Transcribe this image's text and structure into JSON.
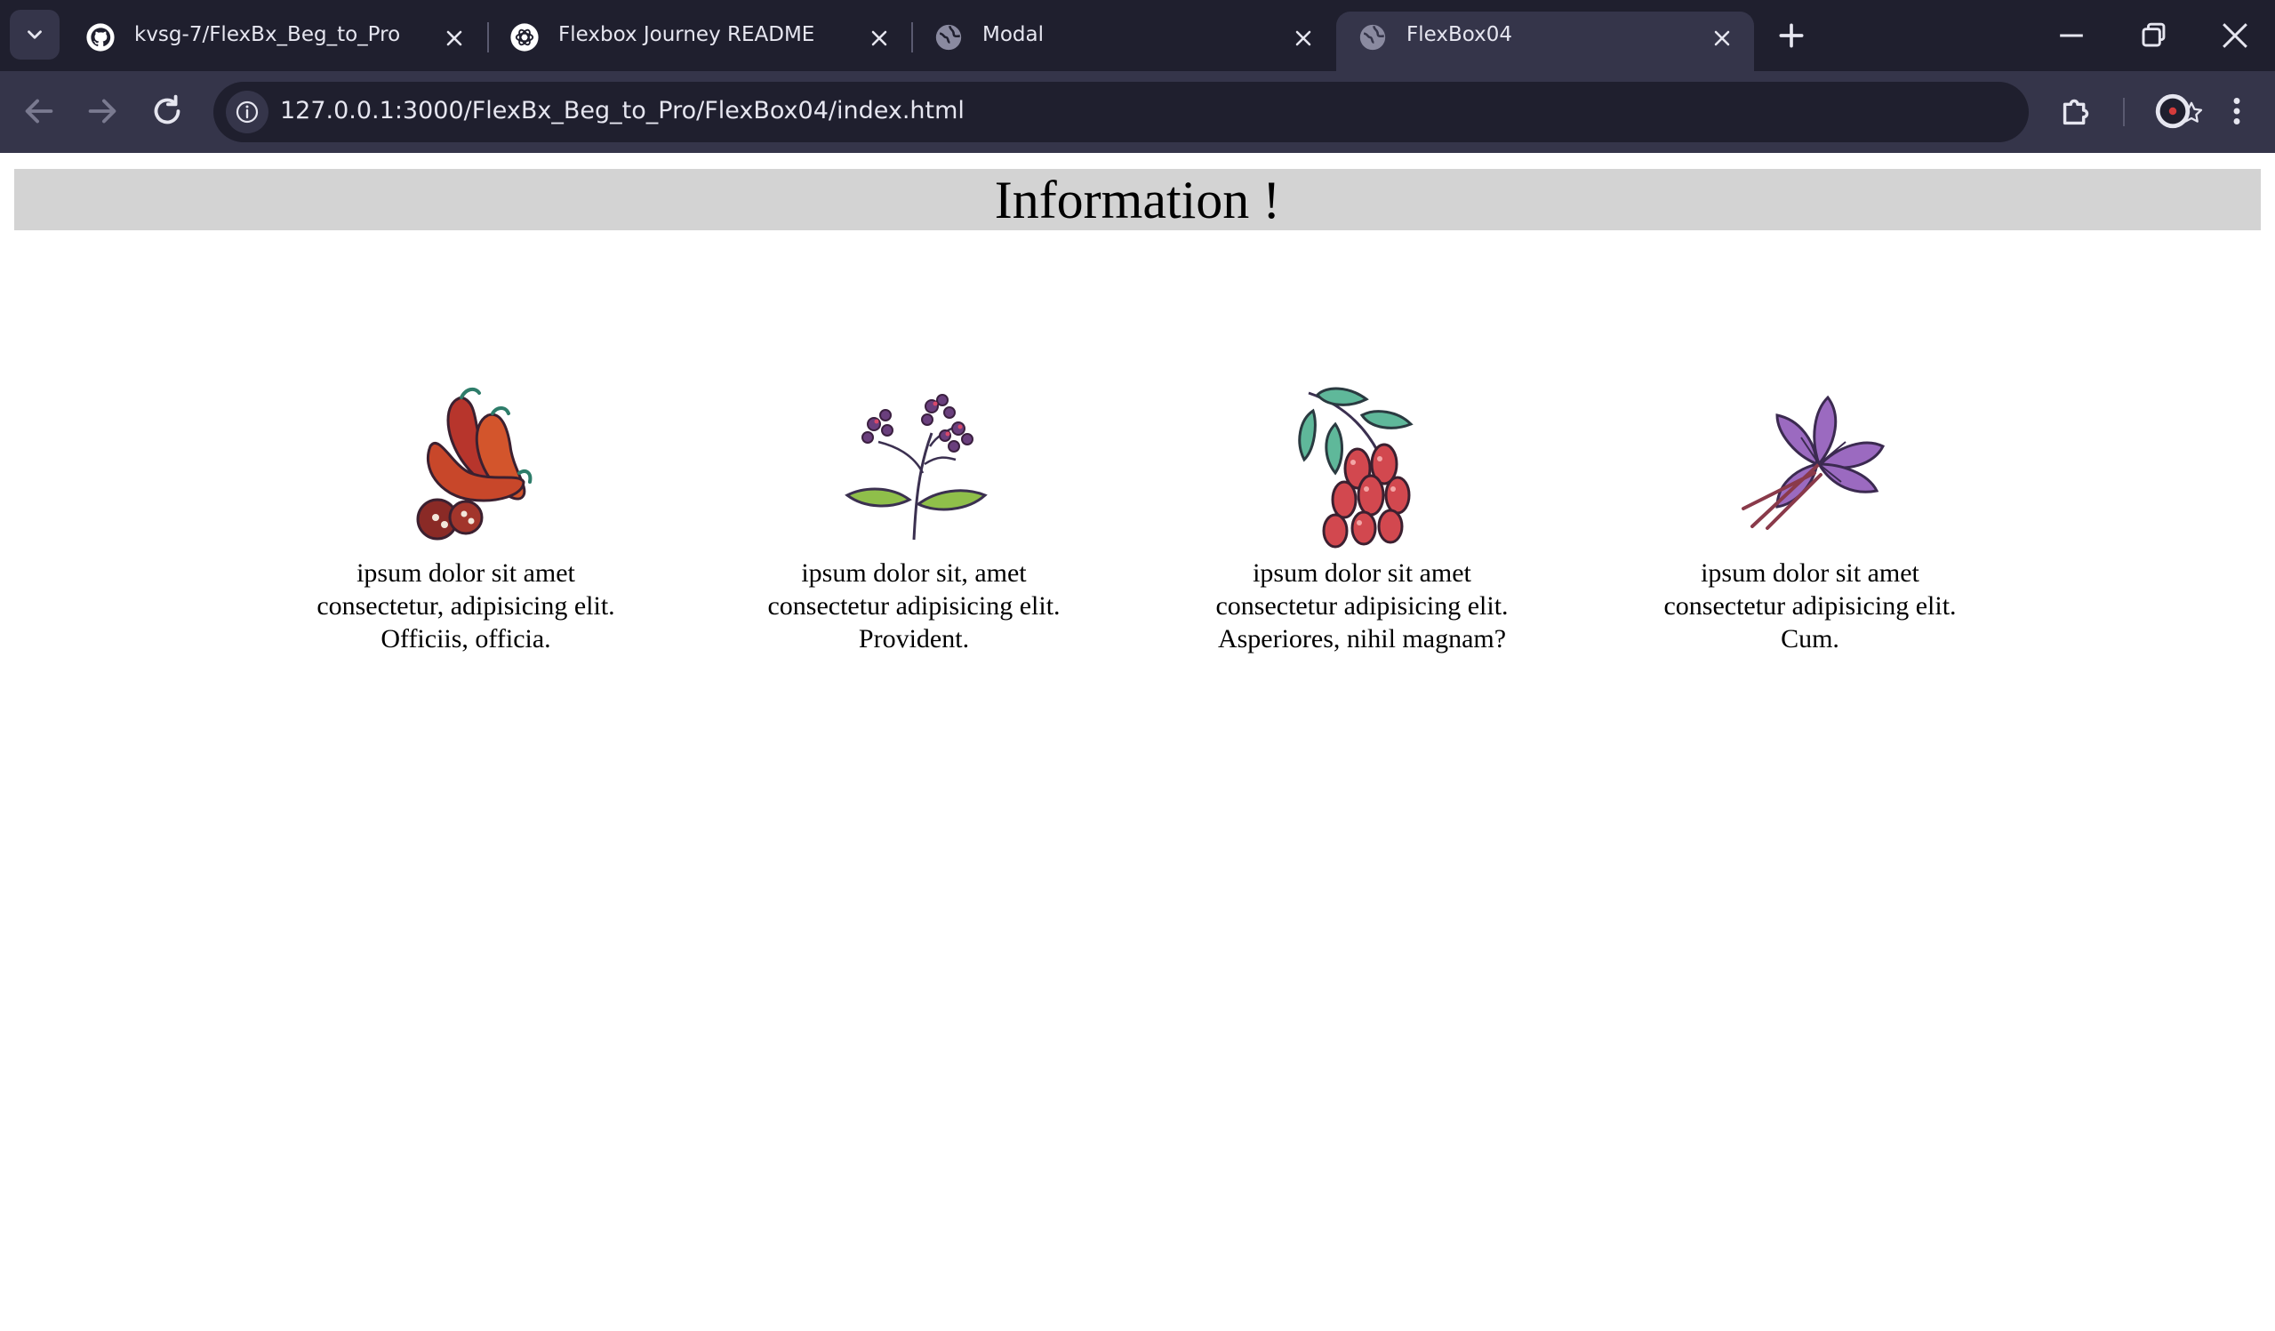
{
  "browser": {
    "tabs": [
      {
        "title": "kvsg-7/FlexBx_Beg_to_Pro",
        "favicon": "github-icon",
        "active": false
      },
      {
        "title": "Flexbox Journey README",
        "favicon": "openai-icon",
        "active": false
      },
      {
        "title": "Modal",
        "favicon": "globe-icon",
        "active": false
      },
      {
        "title": "FlexBox04",
        "favicon": "globe-icon",
        "active": true
      }
    ],
    "address": {
      "host": "127.0.0.1",
      "rest": ":3000/FlexBx_Beg_to_Pro/FlexBox04/index.html"
    },
    "colors": {
      "tabstrip": "#1f1f2e",
      "toolbar": "#35354a",
      "omnibox": "#1f1f2e",
      "text": "#e6e6f0"
    }
  },
  "page": {
    "heading": "Information !",
    "banner_color": "#d3d3d3",
    "cards": [
      {
        "icon": "chili-peppers-icon",
        "lines": [
          "ipsum dolor sit amet",
          "consectetur, adipisicing elit.",
          "Officiis, officia."
        ]
      },
      {
        "icon": "flowering-herb-icon",
        "lines": [
          "ipsum dolor sit, amet",
          "consectetur adipisicing elit.",
          "Provident."
        ]
      },
      {
        "icon": "red-berries-icon",
        "lines": [
          "ipsum dolor sit amet",
          "consectetur adipisicing elit.",
          "Asperiores, nihil magnam?"
        ]
      },
      {
        "icon": "saffron-flower-icon",
        "lines": [
          "ipsum dolor sit amet",
          "consectetur adipisicing elit.",
          "Cum."
        ]
      }
    ]
  }
}
